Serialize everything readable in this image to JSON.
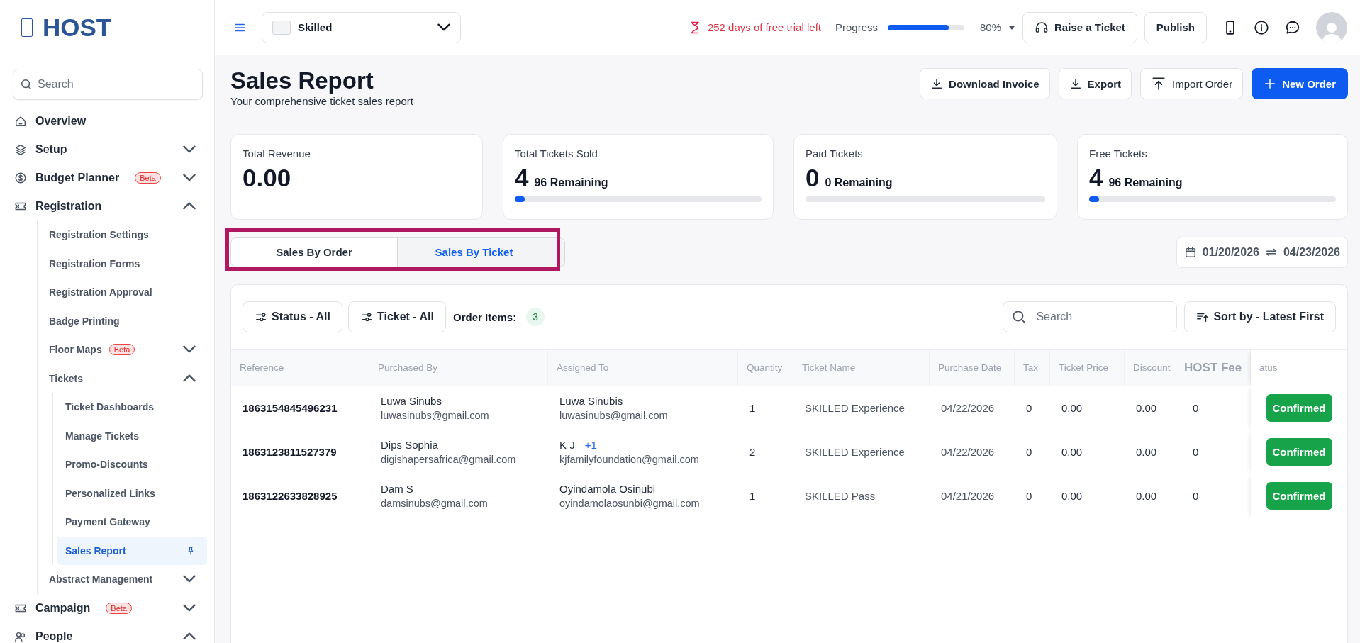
{
  "logo": {
    "text": "HOST"
  },
  "sidebar": {
    "search": {
      "placeholder": "Search"
    },
    "items": [
      {
        "label": "Overview",
        "selected": false
      },
      {
        "label": "Setup",
        "selected": false,
        "expanded": false
      },
      {
        "label": "Budget Planner",
        "badge": "Beta",
        "selected": false,
        "expanded": false
      },
      {
        "label": "Registration",
        "selected": false,
        "expanded": true,
        "children": [
          {
            "label": "Registration Settings",
            "selected": false
          },
          {
            "label": "Registration Forms",
            "selected": false
          },
          {
            "label": "Registration Approval",
            "selected": false
          },
          {
            "label": "Badge Printing",
            "selected": false
          },
          {
            "label": "Floor Maps",
            "badge": "Beta",
            "selected": false,
            "expanded": false
          },
          {
            "label": "Tickets",
            "selected": false,
            "expanded": true,
            "children": [
              {
                "label": "Ticket Dashboards",
                "selected": false
              },
              {
                "label": "Manage Tickets",
                "selected": false
              },
              {
                "label": "Promo-Discounts",
                "selected": false
              },
              {
                "label": "Personalized Links",
                "selected": false
              },
              {
                "label": "Payment Gateway",
                "selected": false
              },
              {
                "label": "Sales Report",
                "selected": true
              }
            ]
          },
          {
            "label": "Abstract Management",
            "selected": false,
            "expanded": false
          }
        ]
      },
      {
        "label": "Campaign",
        "badge": "Beta",
        "selected": false,
        "expanded": false
      },
      {
        "label": "People",
        "selected": false,
        "expanded": true
      }
    ]
  },
  "header": {
    "event": {
      "name": "Skilled"
    },
    "trial": "252 days of free trial left",
    "progress": {
      "label": "Progress",
      "level": 0.8,
      "reading": "80%"
    },
    "buttons": [
      {
        "label": "Raise a Ticket",
        "kind": "support"
      },
      {
        "label": "Publish",
        "kind": "plain"
      }
    ]
  },
  "page": {
    "title": "Sales Report",
    "subtitle": "Your comprehensive ticket sales report",
    "actions": [
      {
        "label": "Download Invoice",
        "kind": "download"
      },
      {
        "label": "Export",
        "kind": "download"
      },
      {
        "label": "Import Order",
        "kind": "upload"
      },
      {
        "label": "New Order",
        "kind": "primary"
      }
    ]
  },
  "stats": [
    {
      "label": "Total Revenue",
      "value": "0.00"
    },
    {
      "label": "Total Tickets Sold",
      "value": "4",
      "remaining": "96 Remaining",
      "level": 0.04
    },
    {
      "label": "Paid Tickets",
      "value": "0",
      "remaining": "0 Remaining",
      "level": 0
    },
    {
      "label": "Free Tickets",
      "value": "4",
      "remaining": "96 Remaining",
      "level": 0.04
    }
  ],
  "tabs": [
    {
      "label": "Sales By Order",
      "selected": false
    },
    {
      "label": "Sales By Ticket",
      "selected": true
    }
  ],
  "date_range": {
    "start": "01/20/2026",
    "end": "04/23/2026"
  },
  "toolbar": {
    "filters": [
      {
        "label": "Status - All"
      },
      {
        "label": "Ticket - All"
      }
    ],
    "order_items": {
      "label": "Order Items:",
      "count": "3"
    },
    "search": {
      "placeholder": "Search"
    },
    "sort": "Sort by - Latest First"
  },
  "table": {
    "columns": [
      "Reference",
      "Purchased By",
      "Assigned To",
      "Quantity",
      "Ticket Name",
      "Purchase Date",
      "Tax",
      "Ticket Price",
      "Discount",
      "HOST Fee",
      "atus"
    ],
    "rows": [
      {
        "reference": "1863154845496231",
        "purchaser": {
          "name": "Luwa Sinubs",
          "email": "luwasinubs@gmail.com"
        },
        "assignee": {
          "name": "Luwa Sinubis",
          "email": "luwasinubs@gmail.com"
        },
        "quantity": "1",
        "ticket": "SKILLED Experience",
        "date": "04/22/2026",
        "tax": "0",
        "price": "0.00",
        "discount": "0.00",
        "fee": "0",
        "status": "Confirmed"
      },
      {
        "reference": "1863123811527379",
        "purchaser": {
          "name": "Dips Sophia",
          "email": "digishapersafrica@gmail.com"
        },
        "assignee": {
          "name": "K J",
          "extra": "+1",
          "email": "kjfamilyfoundation@gmail.com"
        },
        "quantity": "2",
        "ticket": "SKILLED Experience",
        "date": "04/22/2026",
        "tax": "0",
        "price": "0.00",
        "discount": "0.00",
        "fee": "0",
        "status": "Confirmed"
      },
      {
        "reference": "1863122633828925",
        "purchaser": {
          "name": "Dam S",
          "email": "damsinubs@gmail.com"
        },
        "assignee": {
          "name": "Oyindamola Osinubi",
          "email": "oyindamolaosunbi@gmail.com"
        },
        "quantity": "1",
        "ticket": "SKILLED Pass",
        "date": "04/21/2026",
        "tax": "0",
        "price": "0.00",
        "discount": "0.00",
        "fee": "0",
        "status": "Confirmed"
      }
    ]
  }
}
